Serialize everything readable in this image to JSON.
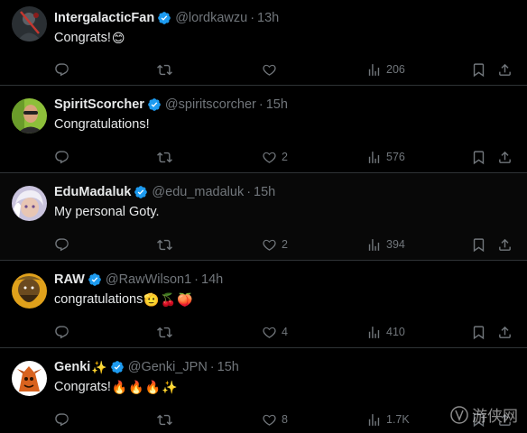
{
  "colors": {
    "background": "#000000",
    "text": "#e7e9ea",
    "muted": "#71767b",
    "verified": "#1d9bf0",
    "divider": "#2f3336"
  },
  "tweets": [
    {
      "name": "IntergalacticFan",
      "handle": "@lordkawzu",
      "sep": "·",
      "time": "13h",
      "text": "Congrats!",
      "emojis": [
        "😊"
      ],
      "likes": "",
      "views": "206",
      "avatar": "dark-figure-avatar"
    },
    {
      "name": "SpiritScorcher",
      "handle": "@spiritscorcher",
      "sep": "·",
      "time": "15h",
      "text": "Congratulations!",
      "emojis": [],
      "likes": "2",
      "views": "576",
      "avatar": "bald-man-avatar"
    },
    {
      "name": "EduMadaluk",
      "handle": "@edu_madaluk",
      "sep": "·",
      "time": "15h",
      "text": "My personal Goty.",
      "emojis": [],
      "likes": "2",
      "views": "394",
      "avatar": "anime-character-avatar"
    },
    {
      "name": "RAW",
      "handle": "@RawWilson1",
      "sep": "·",
      "time": "14h",
      "text": "congratulations",
      "emojis": [
        "🫡",
        "🍒",
        "🍑"
      ],
      "likes": "4",
      "views": "410",
      "avatar": "bearded-character-avatar"
    },
    {
      "name": "Genki",
      "name_emoji": "✨",
      "handle": "@Genki_JPN",
      "sep": "·",
      "time": "15h",
      "text": "Congrats!",
      "emojis": [
        "🔥",
        "🔥",
        "🔥",
        "✨"
      ],
      "likes": "8",
      "views": "1.7K",
      "avatar": "orange-creature-avatar"
    }
  ],
  "watermark": {
    "text": "游侠网"
  }
}
